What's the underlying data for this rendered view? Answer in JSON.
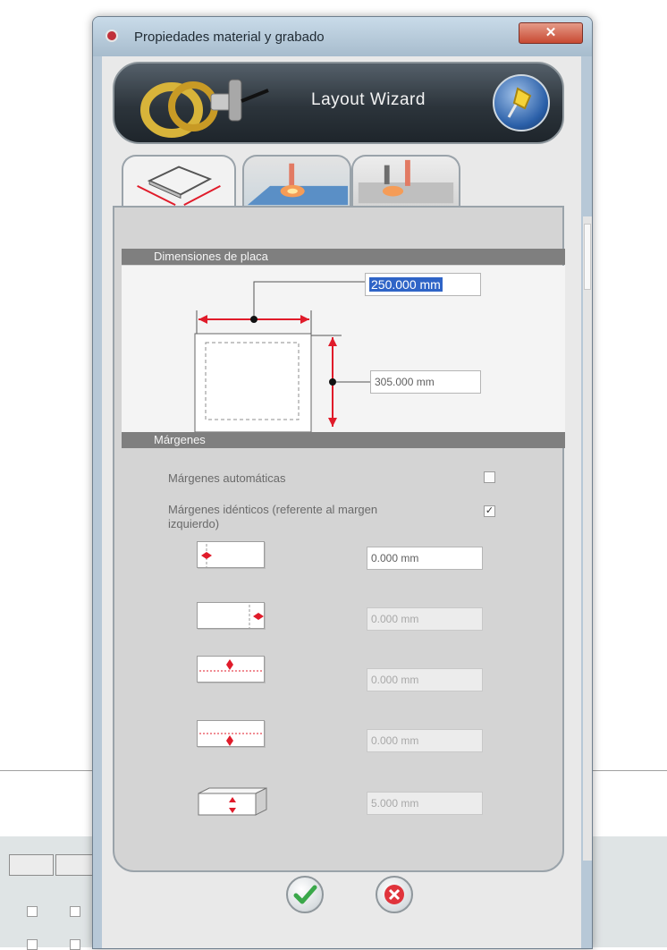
{
  "window": {
    "title": "Propiedades material y grabado",
    "close_glyph": "✕"
  },
  "banner": {
    "title": "Layout Wizard",
    "icons": [
      "rings-logo-icon",
      "pushpin-icon"
    ]
  },
  "tabs": [
    {
      "name": "tab-dimensions",
      "icon": "plate-dimensions-icon",
      "active": true
    },
    {
      "name": "tab-laser",
      "icon": "laser-surface-icon",
      "active": false
    },
    {
      "name": "tab-engraving",
      "icon": "laser-engraving-icon",
      "active": false
    }
  ],
  "dimensions": {
    "header": "Dimensiones de placa",
    "width_value": "250.000 mm",
    "height_value": "305.000 mm"
  },
  "margins": {
    "header": "Márgenes",
    "auto_label": "Márgenes automáticas",
    "auto_checked": false,
    "identical_label": "Márgenes idénticos (referente al margen izquierdo)",
    "identical_checked": true,
    "fields": [
      {
        "icon": "margin-left-icon",
        "value": "0.000 mm",
        "enabled": true
      },
      {
        "icon": "margin-right-icon",
        "value": "0.000 mm",
        "enabled": false
      },
      {
        "icon": "margin-top-icon",
        "value": "0.000 mm",
        "enabled": false
      },
      {
        "icon": "margin-bottom-icon",
        "value": "0.000 mm",
        "enabled": false
      },
      {
        "icon": "thickness-icon",
        "value": "5.000 mm",
        "enabled": false
      }
    ]
  },
  "buttons": {
    "ok_icon": "checkmark-icon",
    "cancel_icon": "cancel-x-icon"
  },
  "colors": {
    "dimension_accent": "#e01b2a",
    "selection": "#2f64c7",
    "section_header": "#7f7f7f"
  }
}
